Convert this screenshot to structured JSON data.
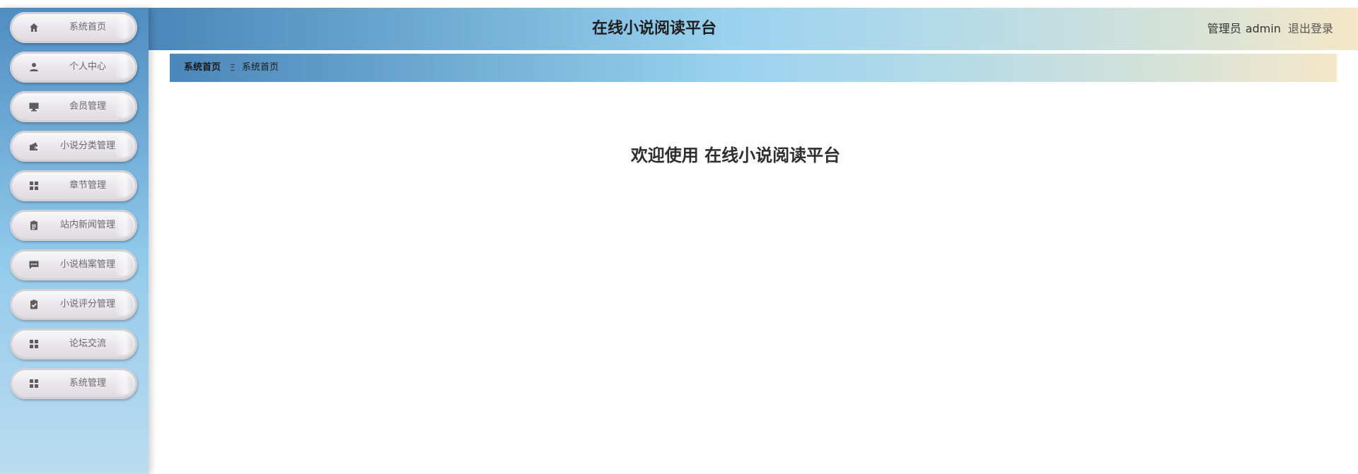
{
  "header": {
    "title": "在线小说阅读平台",
    "role": "管理员",
    "username": "admin",
    "logout": "退出登录"
  },
  "sidebar": {
    "items": [
      {
        "label": "系统首页",
        "icon": "home-icon"
      },
      {
        "label": "个人中心",
        "icon": "person-icon"
      },
      {
        "label": "会员管理",
        "icon": "monitor-icon"
      },
      {
        "label": "小说分类管理",
        "icon": "wallet-icon"
      },
      {
        "label": "章节管理",
        "icon": "grid-icon"
      },
      {
        "label": "站内新闻管理",
        "icon": "clipboard-icon"
      },
      {
        "label": "小说档案管理",
        "icon": "chat-icon"
      },
      {
        "label": "小说评分管理",
        "icon": "clipboard-check-icon"
      },
      {
        "label": "论坛交流",
        "icon": "grid-icon"
      },
      {
        "label": "系统管理",
        "icon": "grid-icon"
      }
    ]
  },
  "breadcrumb": {
    "home": "系统首页",
    "separator": "Ξ",
    "current": "系统首页"
  },
  "main": {
    "welcome": "欢迎使用 在线小说阅读平台"
  },
  "colors": {
    "icon": "#5d5d5d",
    "menu_text": "#6a6a6a",
    "gradient_start": "#4b86b9",
    "gradient_mid": "#9ad2ef",
    "gradient_end": "#f5e7c8"
  }
}
